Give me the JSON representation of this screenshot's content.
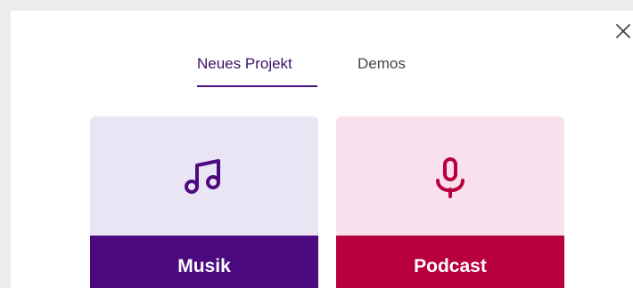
{
  "tabs": {
    "new_project": "Neues Projekt",
    "demos": "Demos"
  },
  "cards": {
    "music": {
      "label": "Musik",
      "icon": "music-note-icon"
    },
    "podcast": {
      "label": "Podcast",
      "icon": "microphone-icon"
    }
  },
  "icons": {
    "close": "close-icon"
  },
  "colors": {
    "tab_active": "#3f1065",
    "music_bg": "#e9e5f5",
    "music_accent": "#4b0a7f",
    "podcast_bg": "#f8e1ec",
    "podcast_accent": "#b8003f"
  }
}
